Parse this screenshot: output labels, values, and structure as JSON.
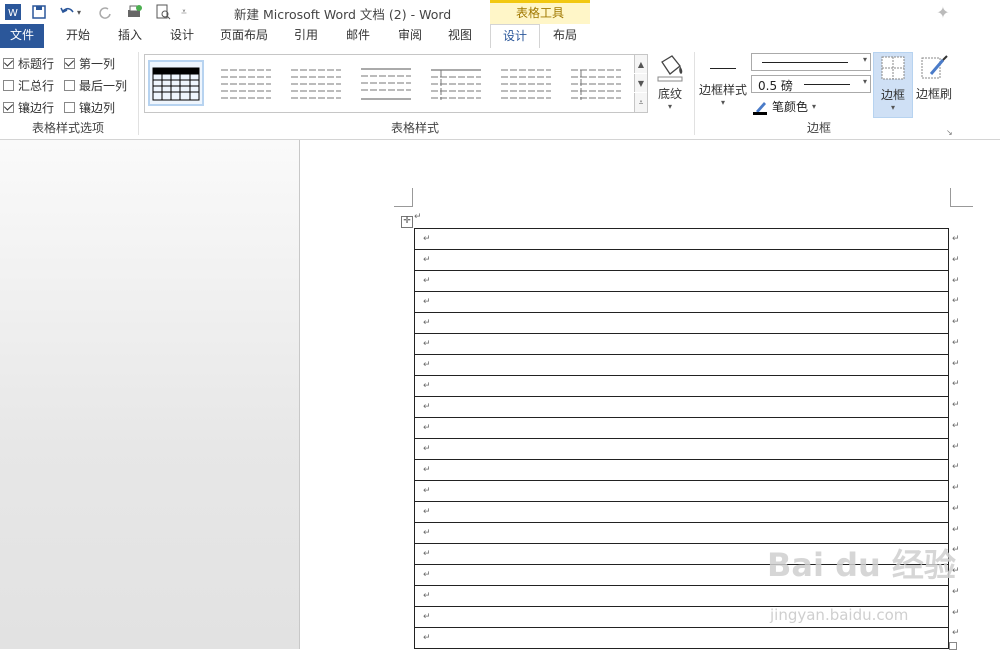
{
  "window": {
    "title": "新建 Microsoft Word 文档 (2) - Word",
    "context_tab_group": "表格工具"
  },
  "tabs": [
    "文件",
    "开始",
    "插入",
    "设计",
    "页面布局",
    "引用",
    "邮件",
    "审阅",
    "视图",
    "设计",
    "布局"
  ],
  "options_group": {
    "label": "表格样式选项",
    "checkboxes": [
      {
        "label": "标题行",
        "checked": true
      },
      {
        "label": "第一列",
        "checked": true
      },
      {
        "label": "汇总行",
        "checked": false
      },
      {
        "label": "最后一列",
        "checked": false
      },
      {
        "label": "镶边行",
        "checked": true
      },
      {
        "label": "镶边列",
        "checked": false
      }
    ]
  },
  "styles_group": {
    "label": "表格样式",
    "shading_label": "底纹"
  },
  "borders_group": {
    "label": "边框",
    "border_styles_label": "边框样式",
    "weight": "0.5 磅",
    "pen_color_label": "笔颜色",
    "borders_label": "边框",
    "border_painter_label": "边框刷"
  },
  "document": {
    "table_rows": 20,
    "cell_mark": "↵"
  },
  "watermark": {
    "brand": "Bai du 经验",
    "url": "jingyan.baidu.com"
  }
}
